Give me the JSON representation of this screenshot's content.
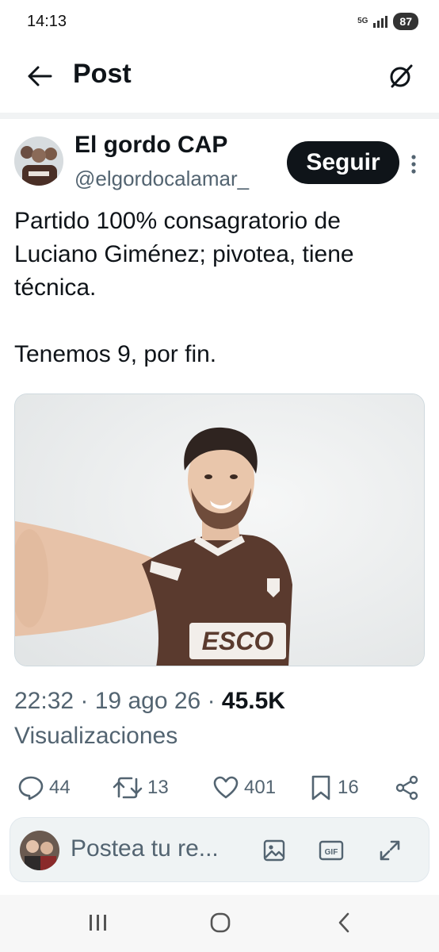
{
  "status_bar": {
    "time": "14:13",
    "network": "5G",
    "battery": "87"
  },
  "header": {
    "title": "Post",
    "back_icon": "arrow-left-icon",
    "grok_icon": "grok-icon"
  },
  "author": {
    "name": "El gordo CAP",
    "handle": "@elgordocalamar_",
    "follow_label": "Seguir"
  },
  "post": {
    "text": "Partido 100% consagratorio de Luciano Giménez; pivotea, tiene técnica.\n\nTenemos 9, por fin.",
    "image_jersey_text": "ESCO"
  },
  "meta": {
    "time": "22:32",
    "date": "19 ago 26",
    "views_count": "45.5K",
    "views_label": "Visualizaciones"
  },
  "actions": {
    "replies": "44",
    "reposts": "13",
    "likes": "401",
    "bookmarks": "16"
  },
  "reply_bar": {
    "placeholder": "Postea tu re...",
    "gif_label": "GIF"
  },
  "colors": {
    "text": "#0f1419",
    "secondary": "#536471",
    "jersey": "#5a3a2e"
  }
}
